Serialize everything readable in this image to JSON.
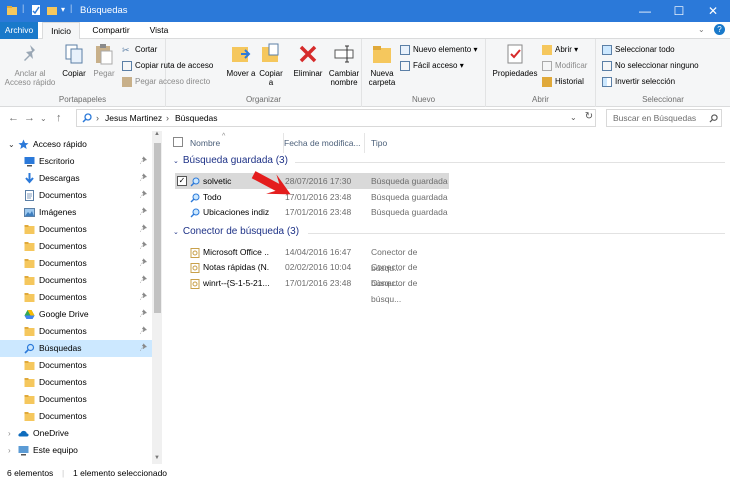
{
  "window": {
    "title": "Búsquedas"
  },
  "tabs": {
    "archivo": "Archivo",
    "inicio": "Inicio",
    "compartir": "Compartir",
    "vista": "Vista"
  },
  "ribbon": {
    "portapapeles": {
      "label": "Portapapeles",
      "anclar": "Anclar al Acceso rápido",
      "copiar": "Copiar",
      "pegar": "Pegar",
      "cortar": "Cortar",
      "copiar_ruta": "Copiar ruta de acceso",
      "pegar_acceso": "Pegar acceso directo"
    },
    "organizar": {
      "label": "Organizar",
      "mover": "Mover a",
      "copiar_a": "Copiar a",
      "eliminar": "Eliminar",
      "cambiar": "Cambiar nombre"
    },
    "nuevo": {
      "label": "Nuevo",
      "nueva_carpeta": "Nueva carpeta",
      "nuevo_elemento": "Nuevo elemento",
      "facil_acceso": "Fácil acceso"
    },
    "abrir": {
      "label": "Abrir",
      "propiedades": "Propiedades",
      "abrir": "Abrir",
      "modificar": "Modificar",
      "historial": "Historial"
    },
    "seleccionar": {
      "label": "Seleccionar",
      "todo": "Seleccionar todo",
      "ninguno": "No seleccionar ninguno",
      "invertir": "Invertir selección"
    }
  },
  "address": {
    "segment1": "Jesus Martinez",
    "segment2": "Búsquedas",
    "search_placeholder": "Buscar en Búsquedas"
  },
  "nav": {
    "items": [
      {
        "label": "Acceso rápido",
        "type": "star",
        "expanded": true
      },
      {
        "label": "Escritorio",
        "type": "desktop",
        "pinned": true
      },
      {
        "label": "Descargas",
        "type": "download",
        "pinned": true
      },
      {
        "label": "Documentos",
        "type": "docs",
        "pinned": true
      },
      {
        "label": "Imágenes",
        "type": "images",
        "pinned": true
      },
      {
        "label": "Documentos",
        "type": "folder",
        "pinned": true
      },
      {
        "label": "Documentos",
        "type": "folder",
        "pinned": true
      },
      {
        "label": "Documentos",
        "type": "folder",
        "pinned": true
      },
      {
        "label": "Documentos",
        "type": "folder",
        "pinned": true
      },
      {
        "label": "Documentos",
        "type": "folder",
        "pinned": true
      },
      {
        "label": "Google Drive",
        "type": "gdrive",
        "pinned": true
      },
      {
        "label": "Documentos",
        "type": "folder",
        "pinned": true
      },
      {
        "label": "Búsquedas",
        "type": "search",
        "pinned": true,
        "selected": true
      },
      {
        "label": "Documentos",
        "type": "folder"
      },
      {
        "label": "Documentos",
        "type": "folder"
      },
      {
        "label": "Documentos",
        "type": "folder"
      },
      {
        "label": "Documentos",
        "type": "folder"
      },
      {
        "label": "OneDrive",
        "type": "onedrive",
        "expandable": true
      },
      {
        "label": "Este equipo",
        "type": "pc",
        "expandable": true
      }
    ]
  },
  "columns": {
    "name": "Nombre",
    "date": "Fecha de modifica...",
    "type": "Tipo"
  },
  "groups": [
    {
      "title": "Búsqueda guardada (3)",
      "rows": [
        {
          "name": "solvetic",
          "date": "28/07/2016 17:30",
          "type": "Búsqueda guardada",
          "selected": true
        },
        {
          "name": "Todo",
          "date": "17/01/2016 23:48",
          "type": "Búsqueda guardada"
        },
        {
          "name": "Ubicaciones indiz...",
          "date": "17/01/2016 23:48",
          "type": "Búsqueda guardada"
        }
      ]
    },
    {
      "title": "Conector de búsqueda (3)",
      "rows": [
        {
          "name": "Microsoft Office ...",
          "date": "14/04/2016 16:47",
          "type": "Conector de búsqu..."
        },
        {
          "name": "Notas rápidas (N...",
          "date": "02/02/2016 10:04",
          "type": "Conector de búsqu..."
        },
        {
          "name": "winrt--{S-1-5-21...",
          "date": "17/01/2016 23:48",
          "type": "Conector de búsqu..."
        }
      ]
    }
  ],
  "status": {
    "count": "6 elementos",
    "selected": "1 elemento seleccionado"
  },
  "colors": {
    "titlebar": "#2b79d9",
    "accent": "#1979ca",
    "selection": "#cce8ff",
    "arrow": "#e41d1d"
  }
}
